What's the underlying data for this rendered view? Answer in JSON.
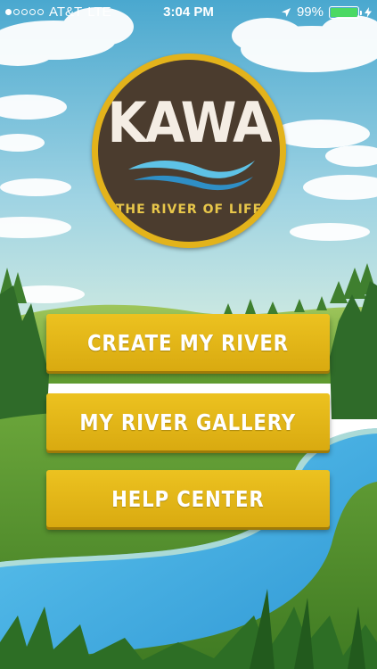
{
  "status_bar": {
    "carrier": "AT&T",
    "network": "LTE",
    "time": "3:04 PM",
    "battery": "99%",
    "battery_level": 0.99,
    "signal_bars": 1,
    "signal_total": 5
  },
  "logo": {
    "title": "KAWA",
    "subtitle": "THE RIVER OF LIFE"
  },
  "menu": {
    "create_label": "CREATE MY RIVER",
    "gallery_label": "MY RIVER GALLERY",
    "help_label": "HELP CENTER"
  },
  "colors": {
    "button": "#e3b51a",
    "logo_ring": "#e3b31b",
    "logo_fill": "#4b3c2e",
    "sky": "#7cc3dc",
    "river": "#4fb6e8",
    "grass": "#6aa339",
    "battery": "#4cd964"
  }
}
